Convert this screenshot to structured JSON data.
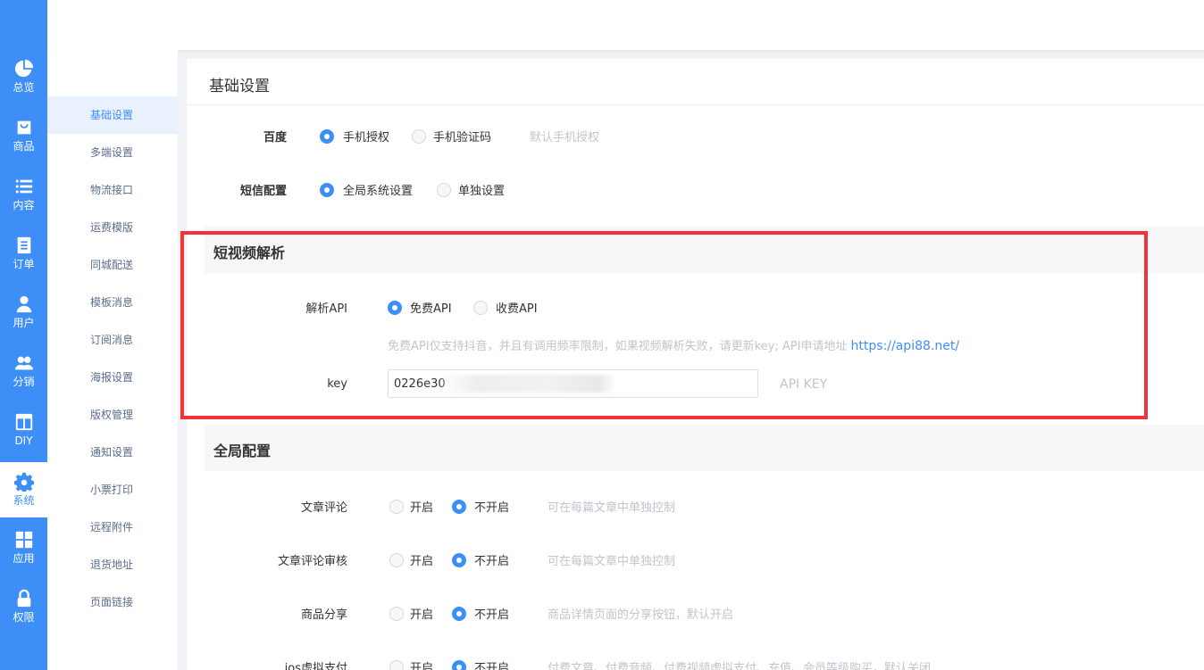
{
  "nav": [
    {
      "label": "总览",
      "icon": "pie-chart-icon"
    },
    {
      "label": "商品",
      "icon": "shopping-bag-icon"
    },
    {
      "label": "内容",
      "icon": "list-icon"
    },
    {
      "label": "订单",
      "icon": "document-icon"
    },
    {
      "label": "用户",
      "icon": "user-icon"
    },
    {
      "label": "分销",
      "icon": "users-icon"
    },
    {
      "label": "DIY",
      "icon": "layout-icon"
    },
    {
      "label": "系统",
      "icon": "gear-icon",
      "active": true
    },
    {
      "label": "应用",
      "icon": "grid-icon"
    },
    {
      "label": "权限",
      "icon": "lock-icon"
    }
  ],
  "submenu": [
    {
      "label": "基础设置",
      "active": true
    },
    {
      "label": "多端设置"
    },
    {
      "label": "物流接口"
    },
    {
      "label": "运费模版"
    },
    {
      "label": "同城配送"
    },
    {
      "label": "模板消息"
    },
    {
      "label": "订阅消息"
    },
    {
      "label": "海报设置"
    },
    {
      "label": "版权管理"
    },
    {
      "label": "通知设置"
    },
    {
      "label": "小票打印"
    },
    {
      "label": "远程附件"
    },
    {
      "label": "退货地址"
    },
    {
      "label": "页面链接"
    }
  ],
  "page": {
    "title": "基础设置"
  },
  "baidu": {
    "label": "百度",
    "opt1": "手机授权",
    "opt2": "手机验证码",
    "hint": "默认手机授权",
    "selected": 1
  },
  "sms": {
    "label": "短信配置",
    "opt1": "全局系统设置",
    "opt2": "单独设置",
    "selected": 1
  },
  "video": {
    "title": "短视频解析",
    "api_label": "解析API",
    "opt1": "免费API",
    "opt2": "收费API",
    "selected": 1,
    "desc": "免费API仅支持抖音，并且有调用频率限制，如果视频解析失败，请更新key; API申请地址 ",
    "link": "https://api88.net/",
    "key_label": "key",
    "key_value": "0226e30",
    "key_hint": "API KEY"
  },
  "global": {
    "title": "全局配置",
    "rows": [
      {
        "label": "文章评论",
        "on": "开启",
        "off": "不开启",
        "selected": 2,
        "hint": "可在每篇文章中单独控制"
      },
      {
        "label": "文章评论审核",
        "on": "开启",
        "off": "不开启",
        "selected": 2,
        "hint": "可在每篇文章中单独控制"
      },
      {
        "label": "商品分享",
        "on": "开启",
        "off": "不开启",
        "selected": 2,
        "hint": "商品详情页面的分享按钮，默认开启"
      },
      {
        "label": "ios虚拟支付",
        "on": "开启",
        "off": "不开启",
        "selected": 2,
        "hint": "付费文章、付费音频、付费视频虚拟支付、充值、会员等级购买，默认关闭"
      }
    ]
  },
  "colors": {
    "primary": "#3e8ef7",
    "highlight": "#f0333b"
  }
}
